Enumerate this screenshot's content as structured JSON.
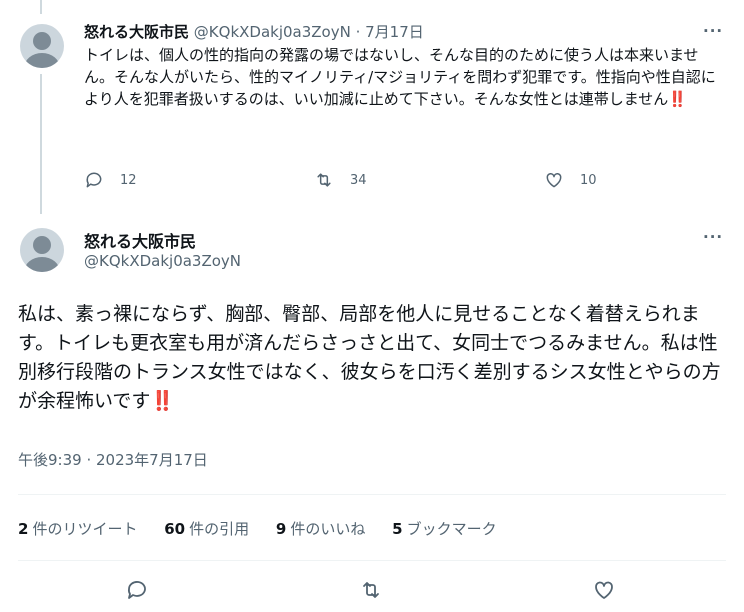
{
  "reply": {
    "name": "怒れる大阪市民",
    "handle": "@KQkXDakj0a3ZoyN",
    "separator": " · ",
    "date": "7月17日",
    "text": "トイレは、個人の性的指向の発露の場ではないし、そんな目的のために使う人は本来いません。そんな人がいたら、性的マイノリティ/マジョリティを問わず犯罪です。性指向や性自認により人を犯罪者扱いするのは、いい加減に止めて下さい。そんな女性とは連帯しません",
    "emoji": "‼️",
    "reply_count": "12",
    "retweet_count": "34",
    "like_count": "10",
    "more": "···"
  },
  "main": {
    "name": "怒れる大阪市民",
    "handle": "@KQkXDakj0a3ZoyN",
    "text": "私は、素っ裸にならず、胸部、臀部、局部を他人に見せることなく着替えられます。トイレも更衣室も用が済んだらさっさと出て、女同士でつるみません。私は性別移行段階のトランス女性ではなく、彼女らを口汚く差別するシス女性とやらの方が余程怖いです",
    "emoji": "‼️",
    "timestamp": "午後9:39 · 2023年7月17日",
    "more": "···"
  },
  "stats": [
    {
      "num": "2",
      "label": "件のリツイート"
    },
    {
      "num": "60",
      "label": "件の引用"
    },
    {
      "num": "9",
      "label": "件のいいね"
    },
    {
      "num": "5",
      "label": "ブックマーク"
    }
  ]
}
